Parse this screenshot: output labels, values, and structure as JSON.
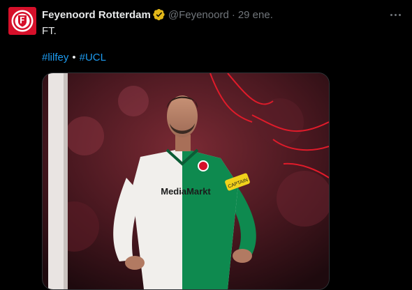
{
  "tweet": {
    "author": {
      "display_name": "Feyenoord Rotterdam",
      "handle": "@Feyenoord",
      "verified_badge_color": "#e2b719",
      "avatar_color": "#d6102a"
    },
    "separator": "·",
    "timestamp": "29 ene.",
    "text": "FT.",
    "hashtags": [
      "#lilfey",
      "#UCL"
    ],
    "hashtag_separator": "•",
    "hashtag_color": "#1d9bf0",
    "media": {
      "kind": "photo",
      "jersey_sponsor": "MediaMarkt",
      "armband_text": "CAPTAIN"
    },
    "icons": {
      "avatar": "feyenoord-crest-icon",
      "verified": "verified-badge-icon",
      "more": "more-options-icon"
    }
  }
}
